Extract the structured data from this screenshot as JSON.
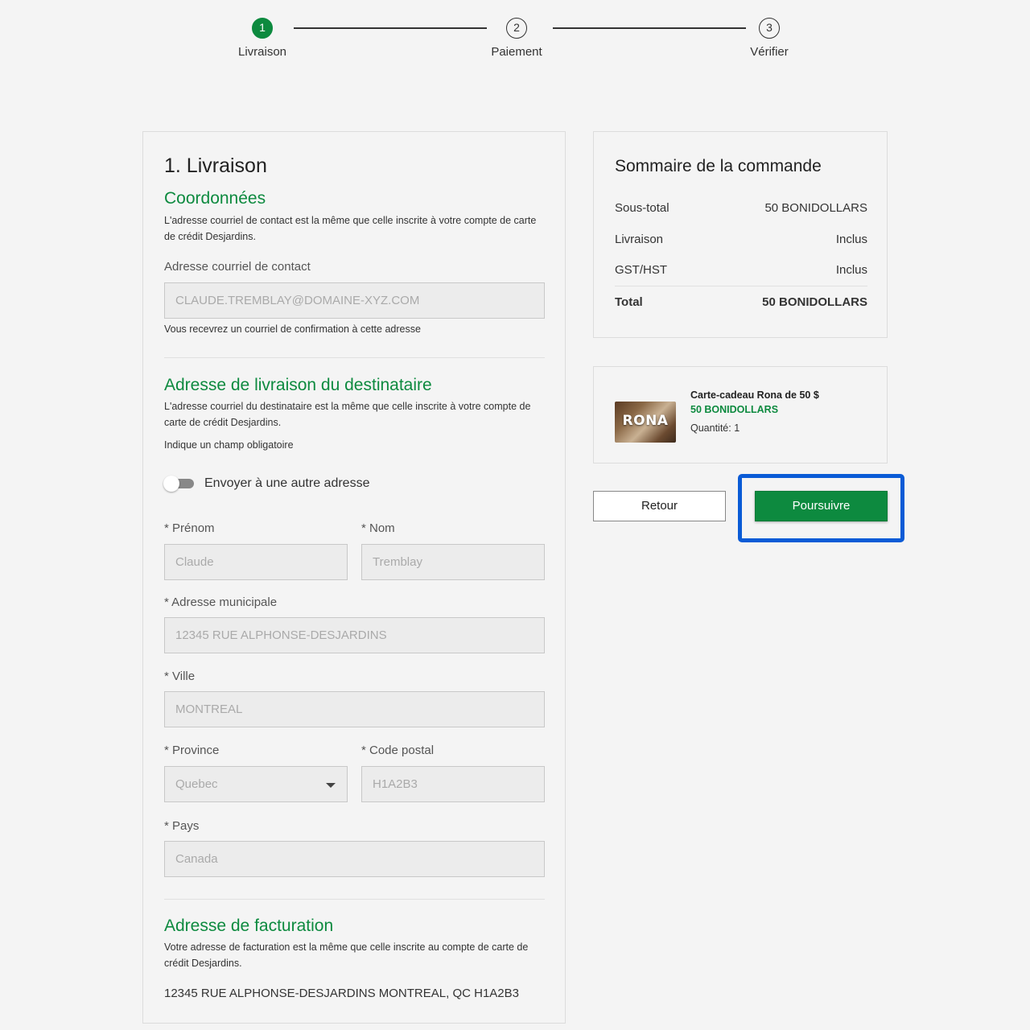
{
  "stepper": {
    "steps": [
      {
        "number": "1",
        "label": "Livraison"
      },
      {
        "number": "2",
        "label": "Paiement"
      },
      {
        "number": "3",
        "label": "Vérifier"
      }
    ],
    "active_step": 1
  },
  "delivery": {
    "title": "1. Livraison",
    "contact": {
      "heading": "Coordonnées",
      "description": "L'adresse courriel de contact est la même que celle inscrite à votre compte de carte de crédit Desjardins.",
      "email_label": "Adresse courriel de contact",
      "email_value": "CLAUDE.TREMBLAY@DOMAINE-XYZ.COM",
      "email_help": "Vous recevrez un courriel de confirmation à cette adresse"
    },
    "recipient": {
      "heading": "Adresse de livraison du destinataire",
      "description": "L'adresse courriel du destinataire est la même que celle inscrite à votre compte de carte de crédit Desjardins.",
      "required_note": "Indique un champ obligatoire",
      "toggle_label": "Envoyer à une autre adresse",
      "toggle_on": false,
      "first_name_label": "* Prénom",
      "first_name_value": "Claude",
      "last_name_label": "* Nom",
      "last_name_value": "Tremblay",
      "street_label": "* Adresse municipale",
      "street_value": "12345 RUE ALPHONSE-DESJARDINS",
      "city_label": "* Ville",
      "city_value": "MONTREAL",
      "province_label": "* Province",
      "province_value": "Quebec",
      "postal_label": "* Code postal",
      "postal_value": "H1A2B3",
      "country_label": "* Pays",
      "country_value": "Canada"
    },
    "billing": {
      "heading": "Adresse de facturation",
      "description": "Votre adresse de facturation est la même que celle inscrite au compte de carte de crédit Desjardins.",
      "address": "12345 RUE ALPHONSE-DESJARDINS MONTREAL, QC H1A2B3"
    }
  },
  "summary": {
    "title": "Sommaire de la commande",
    "rows": [
      {
        "label": "Sous-total",
        "value": "50 BONIDOLLARS"
      },
      {
        "label": "Livraison",
        "value": "Inclus"
      },
      {
        "label": "GST/HST",
        "value": "Inclus"
      }
    ],
    "total_label": "Total",
    "total_value": "50 BONIDOLLARS"
  },
  "product": {
    "name": "Carte-cadeau Rona de 50 $",
    "price": "50 BONIDOLLARS",
    "quantity": "Quantité: 1",
    "thumb_logo": "RONA"
  },
  "actions": {
    "back_label": "Retour",
    "continue_label": "Poursuivre"
  },
  "colors": {
    "accent_green": "#0d8a3f",
    "highlight_blue": "#0a5bd6"
  }
}
